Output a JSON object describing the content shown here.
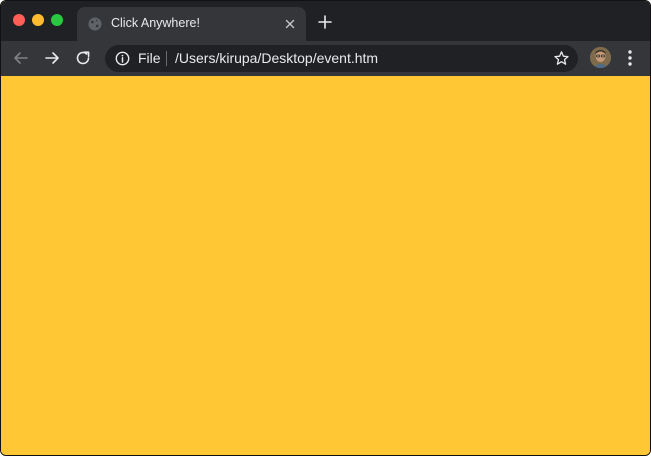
{
  "window": {
    "controls": [
      "close",
      "minimize",
      "maximize"
    ]
  },
  "tab": {
    "title": "Click Anywhere!",
    "favicon": "globe-icon",
    "close_icon": "close-icon"
  },
  "new_tab_icon": "plus-icon",
  "toolbar": {
    "back_icon": "arrow-left-icon",
    "forward_icon": "arrow-right-icon",
    "reload_icon": "reload-icon"
  },
  "omnibox": {
    "security_icon": "info-icon",
    "scheme_label": "File",
    "url": "/Users/kirupa/Desktop/event.htm",
    "bookmark_icon": "star-icon"
  },
  "profile": {
    "avatar": "avatar"
  },
  "menu_icon": "kebab-menu-icon",
  "page": {
    "background_color": "#ffc734"
  },
  "colors": {
    "chrome_dark": "#202124",
    "chrome_tab": "#35363a",
    "text": "#e8eaed"
  }
}
